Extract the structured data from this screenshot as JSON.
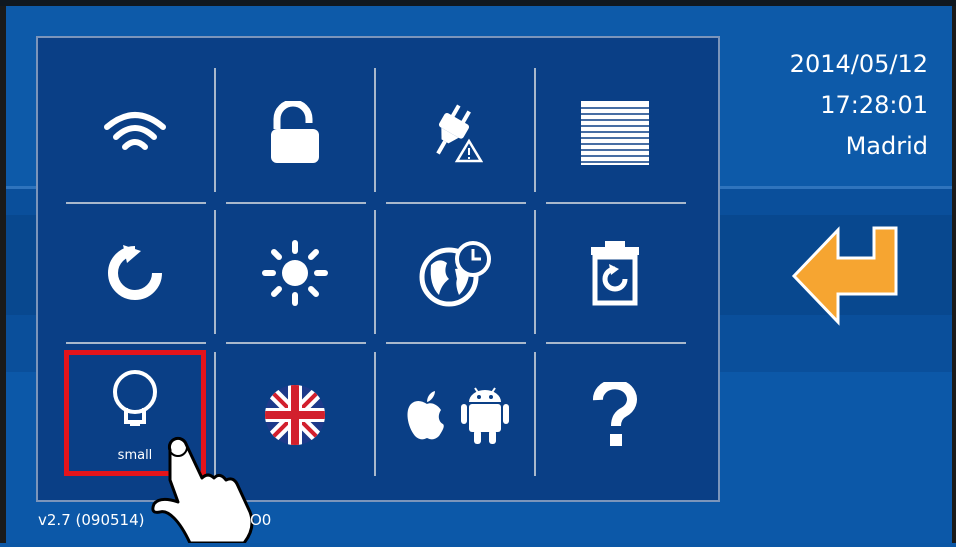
{
  "status": {
    "date": "2014/05/12",
    "time": "17:28:01",
    "city": "Madrid"
  },
  "version_text": "v2.7 (090514)",
  "version_tail": "O0",
  "menu": {
    "items": [
      {
        "name": "wifi",
        "icon": "wifi-icon"
      },
      {
        "name": "unlock",
        "icon": "unlock-icon"
      },
      {
        "name": "power-warning",
        "icon": "plug-warning-icon"
      },
      {
        "name": "blinds",
        "icon": "blinds-icon"
      },
      {
        "name": "refresh",
        "icon": "refresh-icon"
      },
      {
        "name": "brightness",
        "icon": "sun-icon"
      },
      {
        "name": "timezone",
        "icon": "globe-clock-icon"
      },
      {
        "name": "reset",
        "icon": "trash-reset-icon"
      },
      {
        "name": "bulb-size",
        "icon": "lightbulb-icon",
        "label": "small"
      },
      {
        "name": "language",
        "icon": "uk-flag-icon"
      },
      {
        "name": "apps",
        "icon": "apple-android-icon"
      },
      {
        "name": "help",
        "icon": "question-icon"
      }
    ]
  },
  "colors": {
    "panel": "#0a3f86",
    "background": "#0b57a6",
    "highlight": "#e3141b",
    "back_arrow": "#f6a531"
  }
}
